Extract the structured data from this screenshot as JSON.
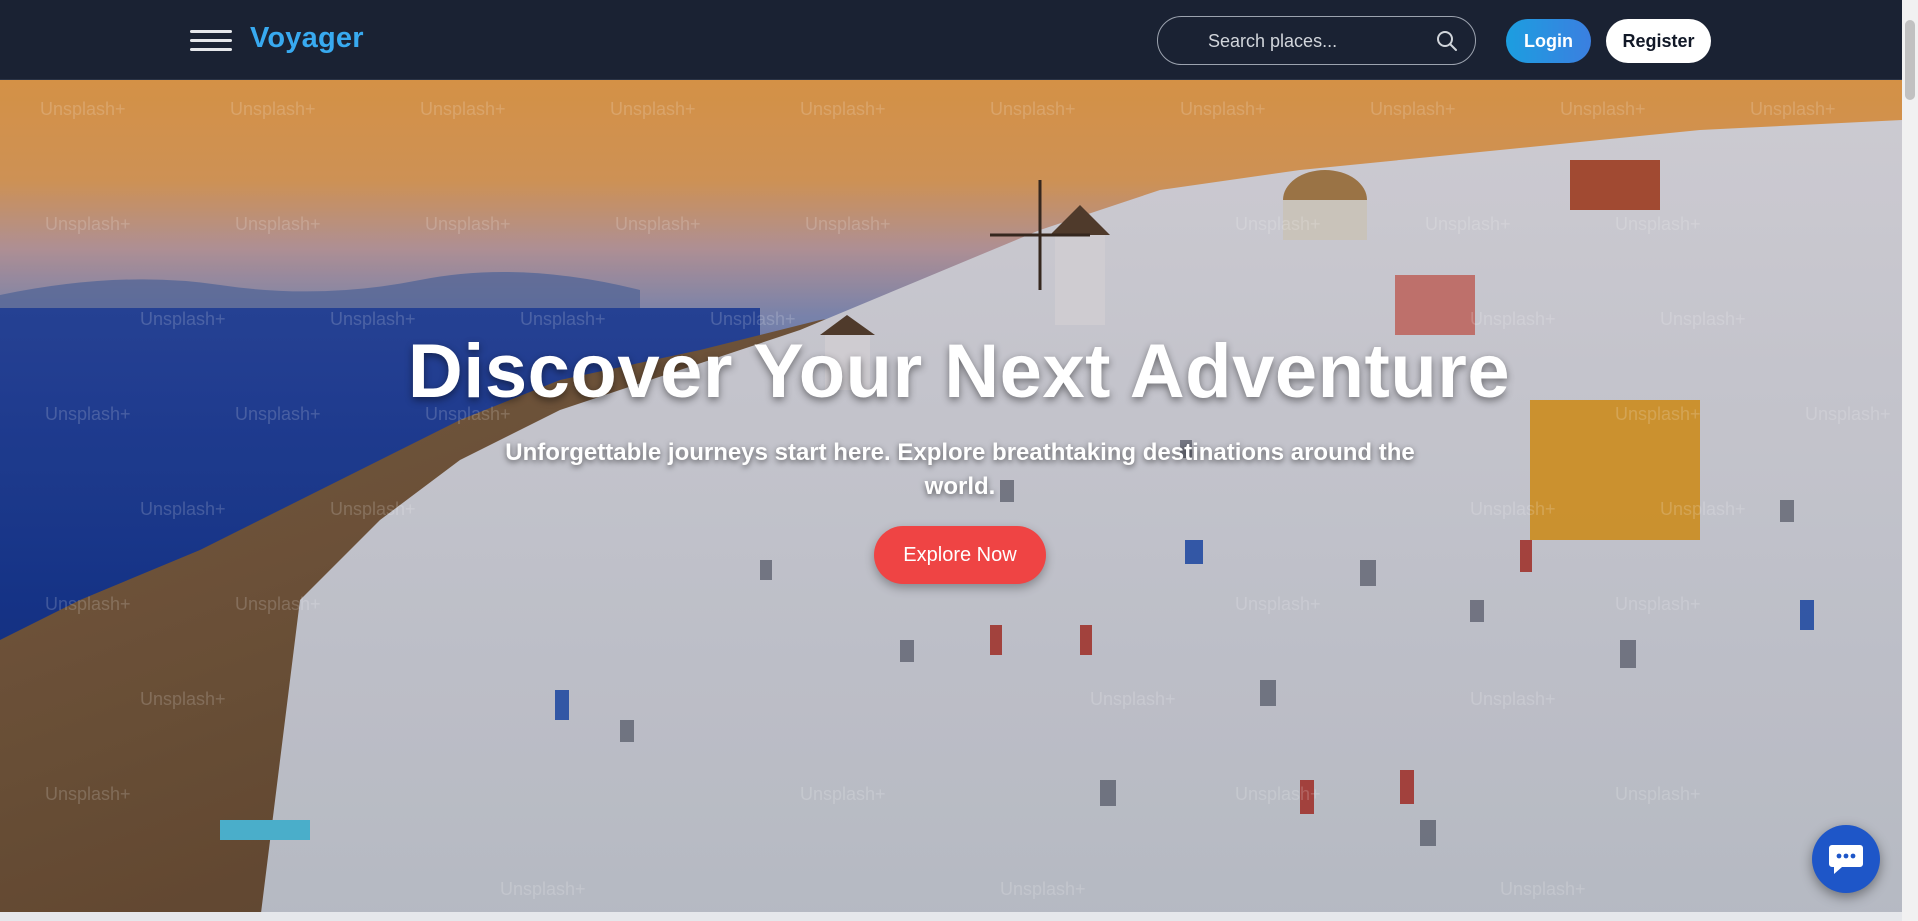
{
  "navbar": {
    "brand": "Voyager",
    "search_placeholder": "Search places...",
    "login_label": "Login",
    "register_label": "Register"
  },
  "hero": {
    "title": "Discover Your Next Adventure",
    "subtitle": "Unforgettable journeys start here. Explore breathtaking destinations around the world.",
    "cta_label": "Explore Now",
    "watermark_text": "Unsplash+"
  },
  "colors": {
    "navbar_bg": "#1a2233",
    "brand": "#38aaf0",
    "login_bg": "#1c9ee0",
    "cta_bg": "#ef4444",
    "chat_bg": "#1e56c8"
  },
  "icons": {
    "menu": "hamburger-icon",
    "search": "search-icon",
    "chat": "chat-bubble-icon"
  }
}
